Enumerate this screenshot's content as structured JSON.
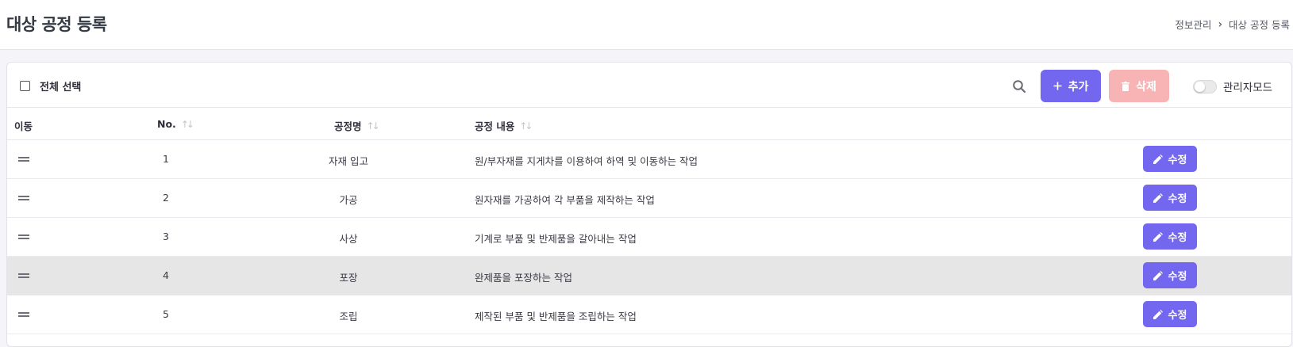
{
  "header": {
    "title": "대상 공정 등록",
    "breadcrumb": [
      "정보관리",
      "대상 공정 등록"
    ],
    "breadcrumb_separator": "›"
  },
  "toolbar": {
    "select_all_label": "전체 선택",
    "add_label": "추가",
    "delete_label": "삭제",
    "admin_mode_label": "관리자모드",
    "admin_mode_on": false
  },
  "table": {
    "columns": {
      "move": "이동",
      "no": "No.",
      "name": "공정명",
      "content": "공정 내용"
    },
    "edit_label": "수정",
    "rows": [
      {
        "no": "1",
        "name": "자재 입고",
        "content": "원/부자재를 지게차를 이용하여 하역 및 이동하는 작업"
      },
      {
        "no": "2",
        "name": "가공",
        "content": "원자재를 가공하여 각 부품을 제작하는 작업"
      },
      {
        "no": "3",
        "name": "사상",
        "content": "기계로 부품 및 반제품을 갈아내는 작업"
      },
      {
        "no": "4",
        "name": "포장",
        "content": "완제품을 포장하는 작업"
      },
      {
        "no": "5",
        "name": "조립",
        "content": "제작된 부품 및 반제품을 조립하는 작업"
      }
    ]
  },
  "colors": {
    "primary": "#7367f0",
    "danger_light": "#f8b3b4",
    "row_highlight": "#e6e6e6"
  }
}
